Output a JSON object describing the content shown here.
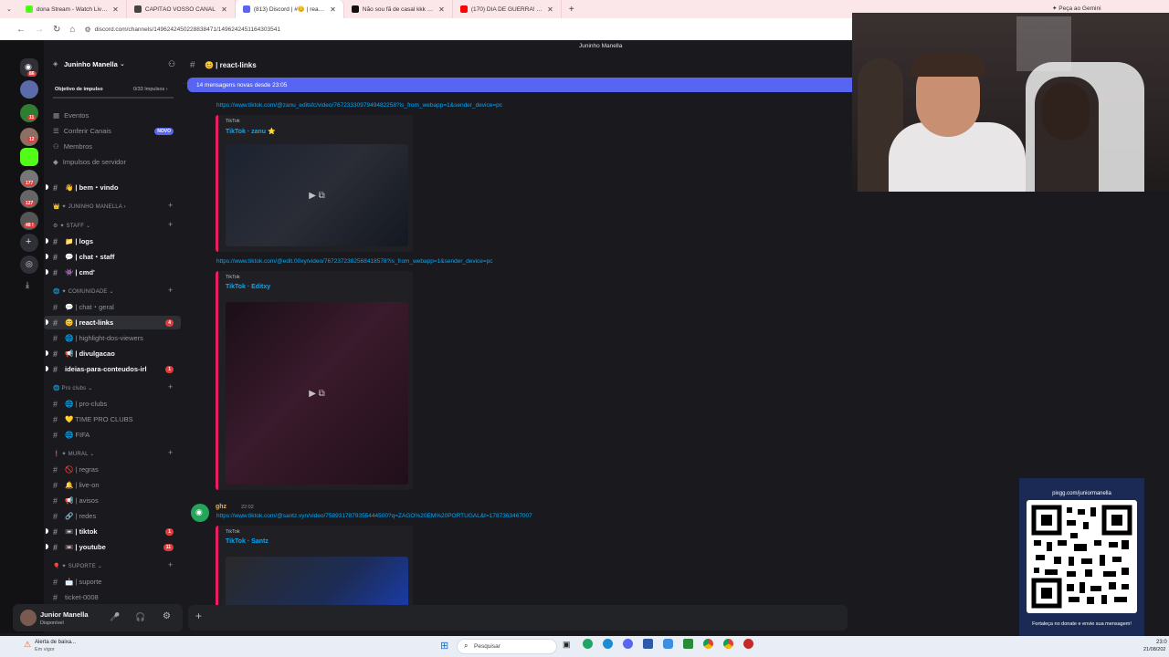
{
  "browser": {
    "tabs": [
      {
        "title": "dona Stream - Watch Live on K",
        "color": "#53fc18",
        "active": false
      },
      {
        "title": "CAPITÃO VOSSO CANAL",
        "color": "#444444",
        "active": false
      },
      {
        "title": "(813) Discord | #😊 | react-links",
        "color": "#5865f2",
        "active": true
      },
      {
        "title": "Não sou fã de casal kkk mais p",
        "color": "#111111",
        "active": false
      },
      {
        "title": "(170) DIA DE GUERRA! TRAIRA",
        "color": "#ff0000",
        "active": false
      }
    ],
    "new_tab": "+",
    "gemini_button": "Peça ao Gemini",
    "url": "discord.com/channels/1496242450228838471/1496242451164303541"
  },
  "stream_top_label": "Juninho Manella",
  "guild_badges": [
    "86",
    "11",
    "12",
    "177",
    "127",
    "48 !"
  ],
  "server": {
    "name": "Juninho Manella",
    "boost_label": "Objetivo de impulso",
    "boost_progress": "0/33 Impulsos ›",
    "nav": [
      "Eventos",
      "Conferir Canais",
      "Membros",
      "Impulsos de servidor"
    ],
    "novo_badge": "NOVO"
  },
  "channels": [
    {
      "name": "👋 | bem・vindo",
      "bold": true
    },
    {
      "cat": "👑 ✦ JUNINHO MANELLA ›"
    },
    {
      "cat": "⚙ ✦ STAFF ⌄"
    },
    {
      "name": "📁 | logs",
      "bold": true
    },
    {
      "name": "💬 | chat・staff",
      "bold": true
    },
    {
      "name": "👾 | cmd'",
      "bold": true
    },
    {
      "cat": "🌐 ✦ COMUNIDADE ⌄"
    },
    {
      "name": "💬 | chat・geral",
      "bold": false
    },
    {
      "name": "😊 | react-links",
      "bold": true,
      "selected": true,
      "count": "4"
    },
    {
      "name": "🌐 | highlight-dos-viewers",
      "bold": false
    },
    {
      "name": "📢 | divulgacao",
      "bold": true
    },
    {
      "name": "ideias-para-conteudos-irl",
      "bold": true,
      "count": "1"
    },
    {
      "cat": "🌐 Pro clubs ⌄"
    },
    {
      "name": "🌐 | pro-clubs",
      "bold": false
    },
    {
      "name": "💛 TIME PRO CLUBS",
      "bold": false
    },
    {
      "name": "🌐 FIFA",
      "bold": false
    },
    {
      "cat": "❗ ✦ MURAL ⌄"
    },
    {
      "name": "🚫 | regras",
      "bold": false
    },
    {
      "name": "🔔 | live-on",
      "bold": false
    },
    {
      "name": "📢 | avisos",
      "bold": false
    },
    {
      "name": "🔗 | redes",
      "bold": false
    },
    {
      "name": "📼 | tiktok",
      "bold": true,
      "count": "1"
    },
    {
      "name": "📼 | youtube",
      "bold": true,
      "count": "11"
    },
    {
      "cat": "🎈 ✦ SUPORTE ⌄"
    },
    {
      "name": "📩 | suporte",
      "bold": false
    },
    {
      "name": "ticket-0008",
      "bold": false
    }
  ],
  "user": {
    "name": "Junior Manella",
    "status": "Disponível"
  },
  "channel_header": {
    "name": "😊 | react-links"
  },
  "new_messages_bar": "14 mensagens novas desde 23:05",
  "messages": [
    {
      "link": "https://www.tiktok.com/@zanu_editsfc/video/7672333097949482258?is_from_webapp=1&sender_device=pc",
      "provider": "TikTok",
      "title": "TikTok · zanu ⭐"
    },
    {
      "link": "https://www.tiktok.com/@edit.00xy/video/7672372382568418578?is_from_webapp=1&sender_device=pc",
      "provider": "TikTok",
      "title": "TikTok · Editxy"
    },
    {
      "author": "ghz",
      "time": "22:02",
      "link": "https://www.tiktok.com/@santz.vyn/video/7589317879355444500?q=ZAGO%20EM%20PORTUGAL&t=1787363467007",
      "provider": "TikTok",
      "title": "TikTok · Santz"
    }
  ],
  "qr": {
    "url": "pixgg.com/juniormanella",
    "caption": "Fortaleça no donate e envie sua mensagem!"
  },
  "taskbar": {
    "alert_title": "Alerta de baixa...",
    "alert_sub": "Em vigor",
    "search": "Pesquisar",
    "clock": "23:0",
    "date": "21/08/202"
  }
}
